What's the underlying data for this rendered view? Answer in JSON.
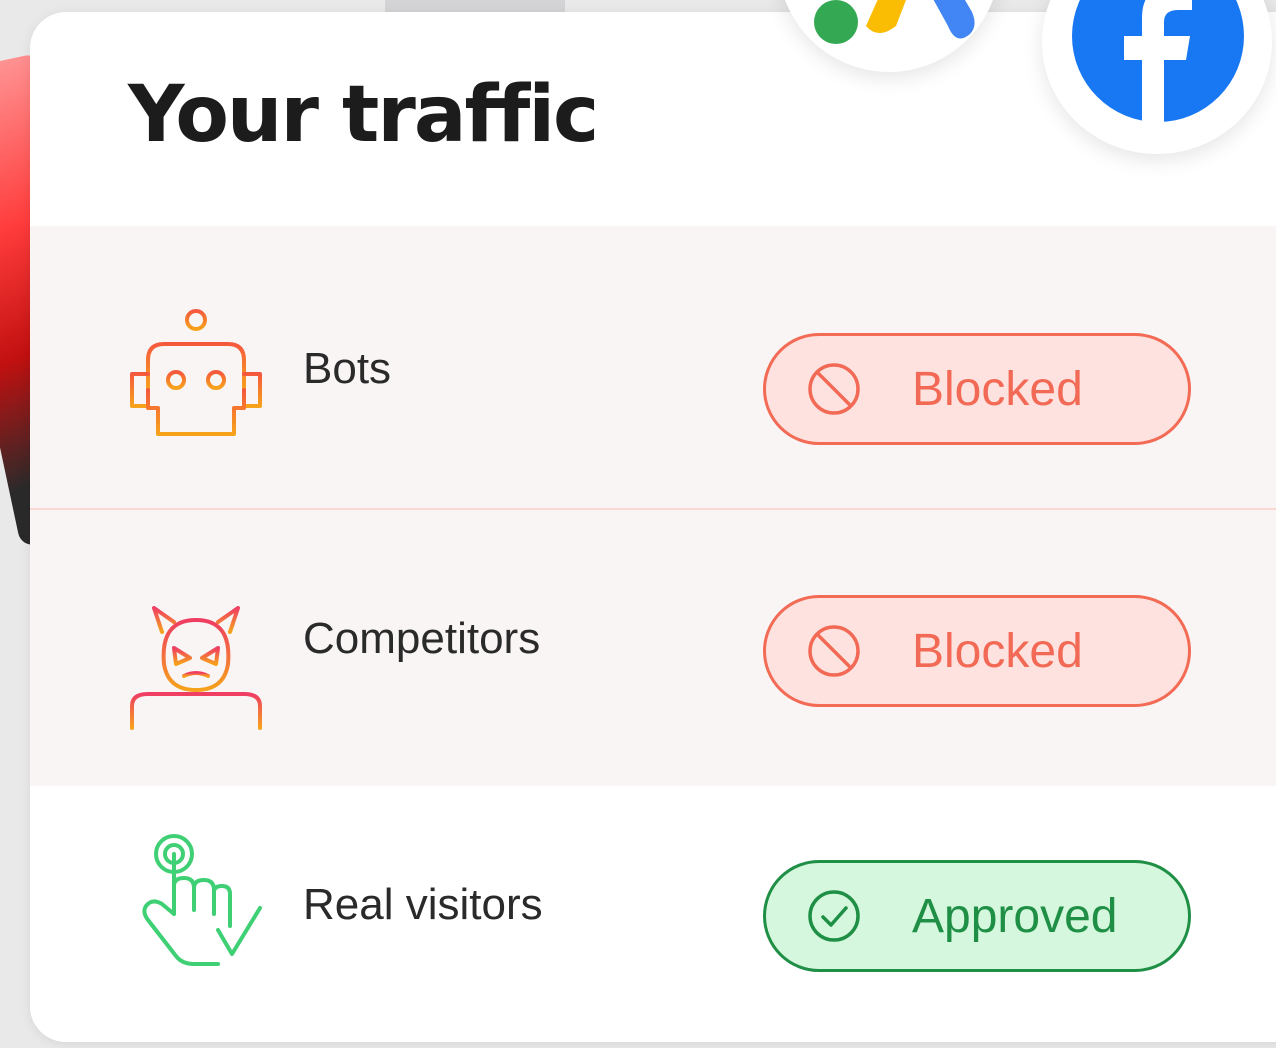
{
  "header": {
    "title": "Your traffic"
  },
  "rows": [
    {
      "label": "Bots",
      "icon": "robot-icon",
      "status": "Blocked",
      "status_icon": "prohibited-icon"
    },
    {
      "label": "Competitors",
      "icon": "devil-icon",
      "status": "Blocked",
      "status_icon": "prohibited-icon"
    },
    {
      "label": "Real visitors",
      "icon": "pointing-hand-icon",
      "status": "Approved",
      "status_icon": "check-circle-icon"
    }
  ],
  "badges": {
    "left": "google-ads-logo",
    "right": "facebook-logo"
  },
  "colors": {
    "blocked_text": "#f26a55",
    "blocked_border": "#f36a55",
    "blocked_bg": "#fde2df",
    "approved_text": "#1f8f46",
    "approved_border": "#1f8f46",
    "approved_bg": "#d4f7dd",
    "row_shade": "#f8f5f4",
    "facebook_blue": "#1877f2"
  }
}
